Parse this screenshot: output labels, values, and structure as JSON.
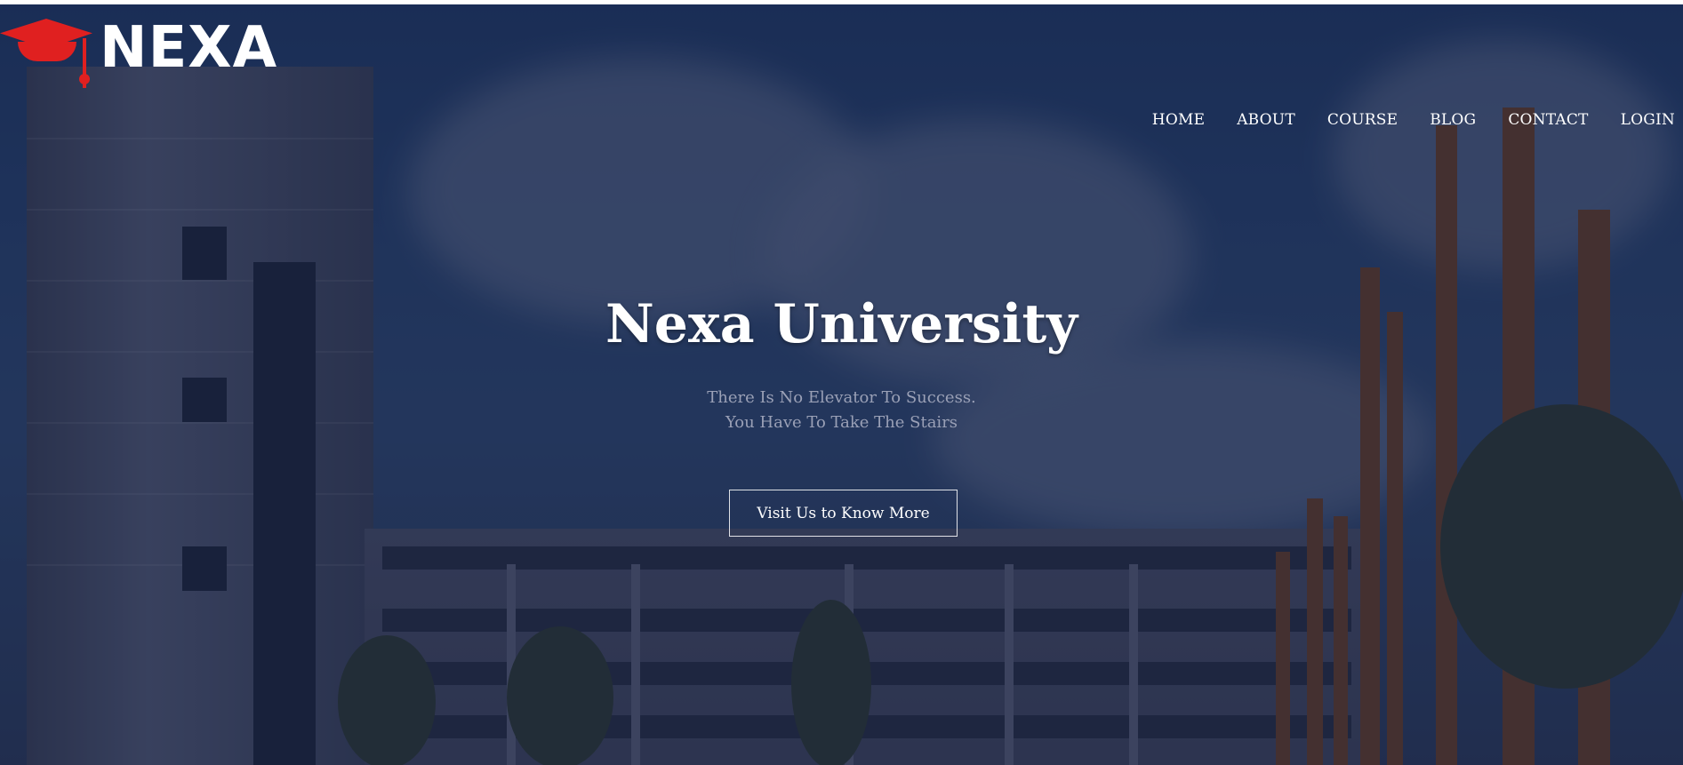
{
  "brand": {
    "name": "NEXA",
    "accent_color": "#e02020",
    "logo_icon": "graduation-cap-icon"
  },
  "nav": {
    "items": [
      {
        "label": "HOME"
      },
      {
        "label": "ABOUT"
      },
      {
        "label": "COURSE"
      },
      {
        "label": "BLOG"
      },
      {
        "label": "CONTACT"
      },
      {
        "label": "LOGIN"
      }
    ]
  },
  "hero": {
    "title": "Nexa University",
    "subtitle_line1": "There Is No Elevator To Success.",
    "subtitle_line2": "You Have To Take The Stairs",
    "cta_label": "Visit Us to Know More"
  }
}
